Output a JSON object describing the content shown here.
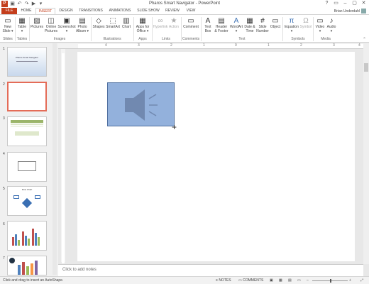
{
  "window": {
    "app_icon": "P",
    "title": "Pharos Smart Navigator - PowerPoint",
    "qat_icons": [
      "save-icon",
      "undo-icon",
      "redo-icon",
      "start-from-beginning-icon",
      "customize-icon"
    ],
    "window_controls": [
      "?",
      "▭",
      "–",
      "▢",
      "✕"
    ]
  },
  "tabs": [
    "FILE",
    "HOME",
    "INSERT",
    "DESIGN",
    "TRANSITIONS",
    "ANIMATIONS",
    "SLIDE SHOW",
    "REVIEW",
    "VIEW"
  ],
  "active_tab": "INSERT",
  "user": {
    "name": "Brian Underdahl"
  },
  "ribbon": {
    "buttons": [
      {
        "id": "new-slide",
        "label1": "New",
        "label2": "Slide ▾",
        "icon": "▭"
      },
      {
        "id": "table",
        "label1": "Table",
        "label2": "▾",
        "icon": "▦"
      },
      {
        "id": "pictures",
        "label1": "Pictures",
        "label2": "",
        "icon": "▨"
      },
      {
        "id": "online-pictures",
        "label1": "Online",
        "label2": "Pictures",
        "icon": "◫"
      },
      {
        "id": "screenshot",
        "label1": "Screenshot",
        "label2": "▾",
        "icon": "▣"
      },
      {
        "id": "photo-album",
        "label1": "Photo",
        "label2": "Album ▾",
        "icon": "▤"
      },
      {
        "id": "shapes",
        "label1": "Shapes",
        "label2": "",
        "icon": "◇"
      },
      {
        "id": "smartart",
        "label1": "SmartArt",
        "label2": "",
        "icon": "⬚"
      },
      {
        "id": "chart",
        "label1": "Chart",
        "label2": "",
        "icon": "▥"
      },
      {
        "id": "apps-for-office",
        "label1": "Apps for",
        "label2": "Office ▾",
        "icon": "▦"
      },
      {
        "id": "hyperlink",
        "label1": "Hyperlink",
        "label2": "",
        "icon": "∞"
      },
      {
        "id": "action",
        "label1": "Action",
        "label2": "",
        "icon": "★"
      },
      {
        "id": "comment",
        "label1": "Comment",
        "label2": "",
        "icon": "▭"
      },
      {
        "id": "text-box",
        "label1": "Text",
        "label2": "Box",
        "icon": "A"
      },
      {
        "id": "header-footer",
        "label1": "Header",
        "label2": "& Footer",
        "icon": "▤"
      },
      {
        "id": "wordart",
        "label1": "WordArt",
        "label2": "▾",
        "icon": "A"
      },
      {
        "id": "date-time",
        "label1": "Date &",
        "label2": "Time",
        "icon": "▦"
      },
      {
        "id": "slide-number",
        "label1": "Slide",
        "label2": "Number",
        "icon": "#"
      },
      {
        "id": "object",
        "label1": "Object",
        "label2": "",
        "icon": "▭"
      },
      {
        "id": "equation",
        "label1": "Equation",
        "label2": "▾",
        "icon": "π"
      },
      {
        "id": "symbol",
        "label1": "Symbol",
        "label2": "",
        "icon": "Ω"
      },
      {
        "id": "video",
        "label1": "Video",
        "label2": "▾",
        "icon": "▭"
      },
      {
        "id": "audio",
        "label1": "Audio",
        "label2": "▾",
        "icon": "♪"
      }
    ],
    "groups": [
      "Slides",
      "Tables",
      "Images",
      "Illustrations",
      "Apps",
      "Links",
      "Comments",
      "Text",
      "Symbols",
      "Media"
    ]
  },
  "ruler": {
    "h_numbers": [
      "4",
      "3",
      "2",
      "1",
      "0",
      "1",
      "2",
      "3",
      "4"
    ]
  },
  "thumbnails": [
    {
      "num": "1",
      "title": "Pharos Smart Navigator"
    },
    {
      "num": "2"
    },
    {
      "num": "3"
    },
    {
      "num": "4"
    },
    {
      "num": "5",
      "title": "Flow Chart"
    },
    {
      "num": "6"
    },
    {
      "num": "7"
    }
  ],
  "notes_placeholder": "Click to add notes",
  "statusbar": {
    "message": "Click and drag to insert an AutoShape.",
    "notes": "NOTES",
    "comments": "COMMENTS",
    "zoom_minus": "–",
    "zoom_plus": "+"
  },
  "colors": {
    "accent": "#c43e1c",
    "audio_icon_fill": "#7f9fd0",
    "thumb_selected": "#e46c58"
  }
}
